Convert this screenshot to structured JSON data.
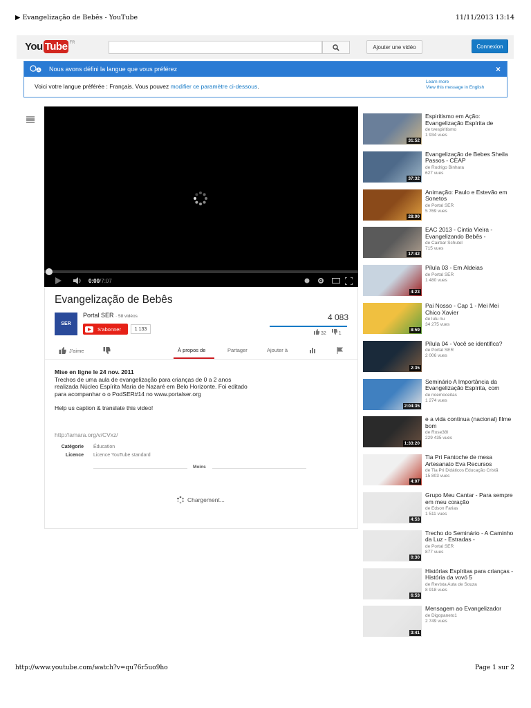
{
  "print": {
    "title": "▶ Evangelização de Bebês - YouTube",
    "date": "11/11/2013 13:14",
    "url": "http://www.youtube.com/watch?v=qu76r5uo9ho",
    "page": "Page 1 sur 2"
  },
  "masthead": {
    "logo_you": "You",
    "logo_tube": "Tube",
    "logo_region": "FR",
    "search_placeholder": "",
    "upload_label": "Ajouter une vidéo",
    "signin_label": "Connexion"
  },
  "notice": {
    "heading": "Nous avons défini la langue que vous préférez",
    "close": "×",
    "message_pre": "Voici votre langue préférée : Français. Vous pouvez ",
    "message_link": "modifier ce paramètre ci-dessous",
    "message_post": ".",
    "learn_more": "Learn more",
    "view_english": "View this message in English"
  },
  "player": {
    "time_current": "0:00",
    "time_sep": " / ",
    "time_total": "7:07",
    "progress": 0.0
  },
  "video": {
    "title": "Evangelização de Bebês",
    "channel_thumb": "SER",
    "channel": "Portal SER",
    "channel_videos": "· 58 vidéos",
    "subscribe": "S'abonner",
    "subscribers": "1 133",
    "views": "4 083",
    "likes": "32",
    "dislikes": "1"
  },
  "actions": {
    "like": "J'aime",
    "about": "À propos de",
    "share": "Partager",
    "add_to": "Ajouter à"
  },
  "description": {
    "published": "Mise en ligne le 24 nov. 2011",
    "text": "Trechos de uma aula de evangelização para crianças de 0 a 2 anos realizada Núcleo Espírita Maria de Nazaré em Belo Horizonte. Foi editado para acompanhar o o PodSER#14 no www.portalser.org",
    "caption": "Help us caption & translate this video!",
    "link": "http://amara.org/v/CVxz/",
    "category_label": "Catégorie",
    "category_value": "Éducation",
    "license_label": "Licence",
    "license_value": "Licence YouTube standard",
    "less": "Moins",
    "loading": "Chargement..."
  },
  "sidebar": [
    {
      "title": "Espiritismo em Ação: Evangelização Espírita de",
      "by": "de tvespiritismo",
      "views": "1 934 vues",
      "duration": "31:52",
      "colors": [
        "#6a7f9a",
        "#c9b48a"
      ]
    },
    {
      "title": "Evangelização de Bebes Sheila Passos - CEAP",
      "by": "de Rodrigo Binhara",
      "views": "627 vues",
      "duration": "37:32",
      "colors": [
        "#4e6a8a",
        "#9fb7c8"
      ]
    },
    {
      "title": "Animação: Paulo e Estevão em Sonetos",
      "by": "de Portal SER",
      "views": "5 769 vues",
      "duration": "28:00",
      "colors": [
        "#8a4a1a",
        "#e0a040"
      ]
    },
    {
      "title": "EAC 2013 - Cintia Vieira - Evangelizando Bebês -",
      "by": "de Cairbar Schutel",
      "views": "715 vues",
      "duration": "17:42",
      "colors": [
        "#5a5a5a",
        "#b0a090"
      ]
    },
    {
      "title": "Pílula 03 - Em Aldeias",
      "by": "de Portal SER",
      "views": "1 480 vues",
      "duration": "4:23",
      "colors": [
        "#c8d4e0",
        "#a02020"
      ]
    },
    {
      "title": "Pai Nosso - Cap 1 - Mei Mei Chico Xavier",
      "by": "de lulu nu",
      "views": "34 275 vues",
      "duration": "8:59",
      "colors": [
        "#f0c040",
        "#60a040"
      ]
    },
    {
      "title": "Pílula 04 - Você se identifica?",
      "by": "de Portal SER",
      "views": "2 006 vues",
      "duration": "2:35",
      "colors": [
        "#1a2a3a",
        "#7a5a40"
      ]
    },
    {
      "title": "Seminário A Importância da Evangelização Espírita, com",
      "by": "de noemoceitas",
      "views": "1 274 vues",
      "duration": "2:04:35",
      "colors": [
        "#4080c0",
        "#e0e0e0"
      ]
    },
    {
      "title": "e a vida continua (nacional) filme bom",
      "by": "de Rose38l",
      "views": "229 435 vues",
      "duration": "1:33:20",
      "colors": [
        "#2a2a2a",
        "#6a5040"
      ]
    },
    {
      "title": "Tia Pri Fantoche de mesa Artesanato Eva Recursos",
      "by": "de Tia Pri Didáticos Educação Cristã",
      "views": "15 803 vues",
      "duration": "4:07",
      "colors": [
        "#f0f0f0",
        "#c04030"
      ]
    },
    {
      "title": "Grupo Meu Cantar - Para sempre em meu coração",
      "by": "de Edson Farias",
      "views": "1 511 vues",
      "duration": "4:53",
      "colors": [
        "#e8e8e8",
        "#e0e0e0"
      ]
    },
    {
      "title": "Trecho do Seminário - A Caminho da Luz - Estradas -",
      "by": "de Portal SER",
      "views": "877 vues",
      "duration": "0:30",
      "colors": [
        "#e8e8e8",
        "#e0e0e0"
      ]
    },
    {
      "title": "Histórias Espíritas para crianças - História da vovó 5",
      "by": "de Revista Auta de Souza",
      "views": "8 918 vues",
      "duration": "6:53",
      "colors": [
        "#e8e8e8",
        "#e0e0e0"
      ]
    },
    {
      "title": "Mensagem ao Evangelizador",
      "by": "de Digopaneto1",
      "views": "2 749 vues",
      "duration": "3:41",
      "colors": [
        "#e8e8e8",
        "#e0e0e0"
      ]
    }
  ]
}
